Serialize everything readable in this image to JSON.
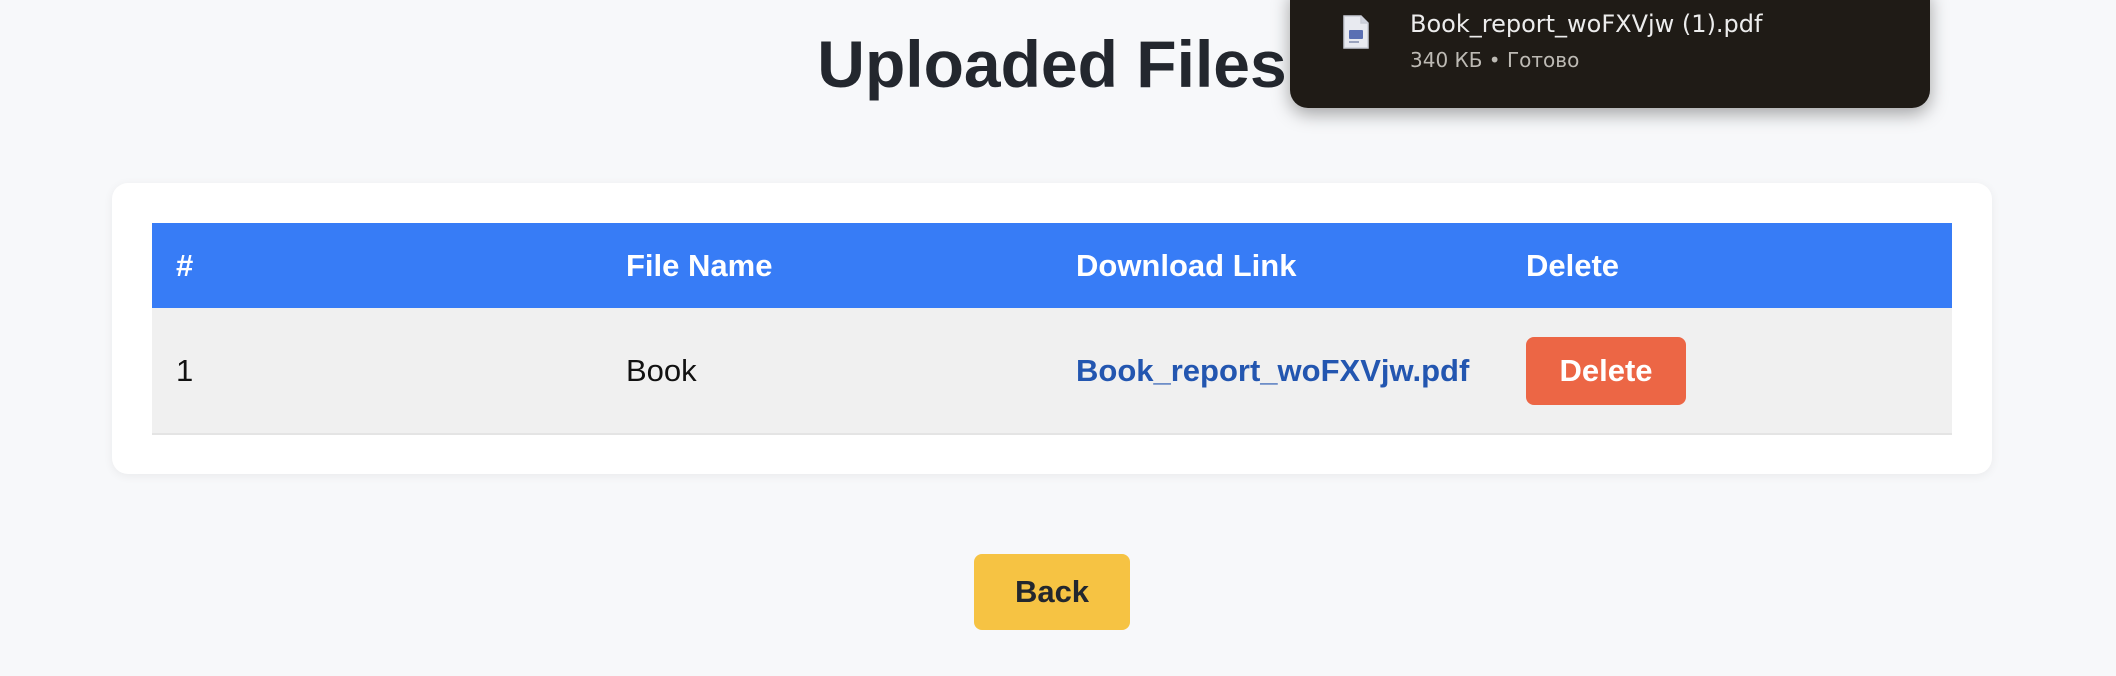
{
  "page": {
    "title": "Uploaded Files"
  },
  "table": {
    "headers": [
      "#",
      "File Name",
      "Download Link",
      "Delete"
    ],
    "rows": [
      {
        "index": "1",
        "file_name": "Book",
        "download_link": "Book_report_woFXVjw.pdf",
        "delete_label": "Delete"
      }
    ]
  },
  "back_button": {
    "label": "Back"
  },
  "download_popup": {
    "file_name": "Book_report_woFXVjw (1).pdf",
    "status": "340 КБ • Готово",
    "icon": "pdf-file-icon"
  },
  "colors": {
    "header_bg": "#377cf6",
    "delete_button": "#ec6645",
    "back_button": "#f6c343",
    "link": "#2356b0",
    "popup_bg": "#1f1b16"
  }
}
